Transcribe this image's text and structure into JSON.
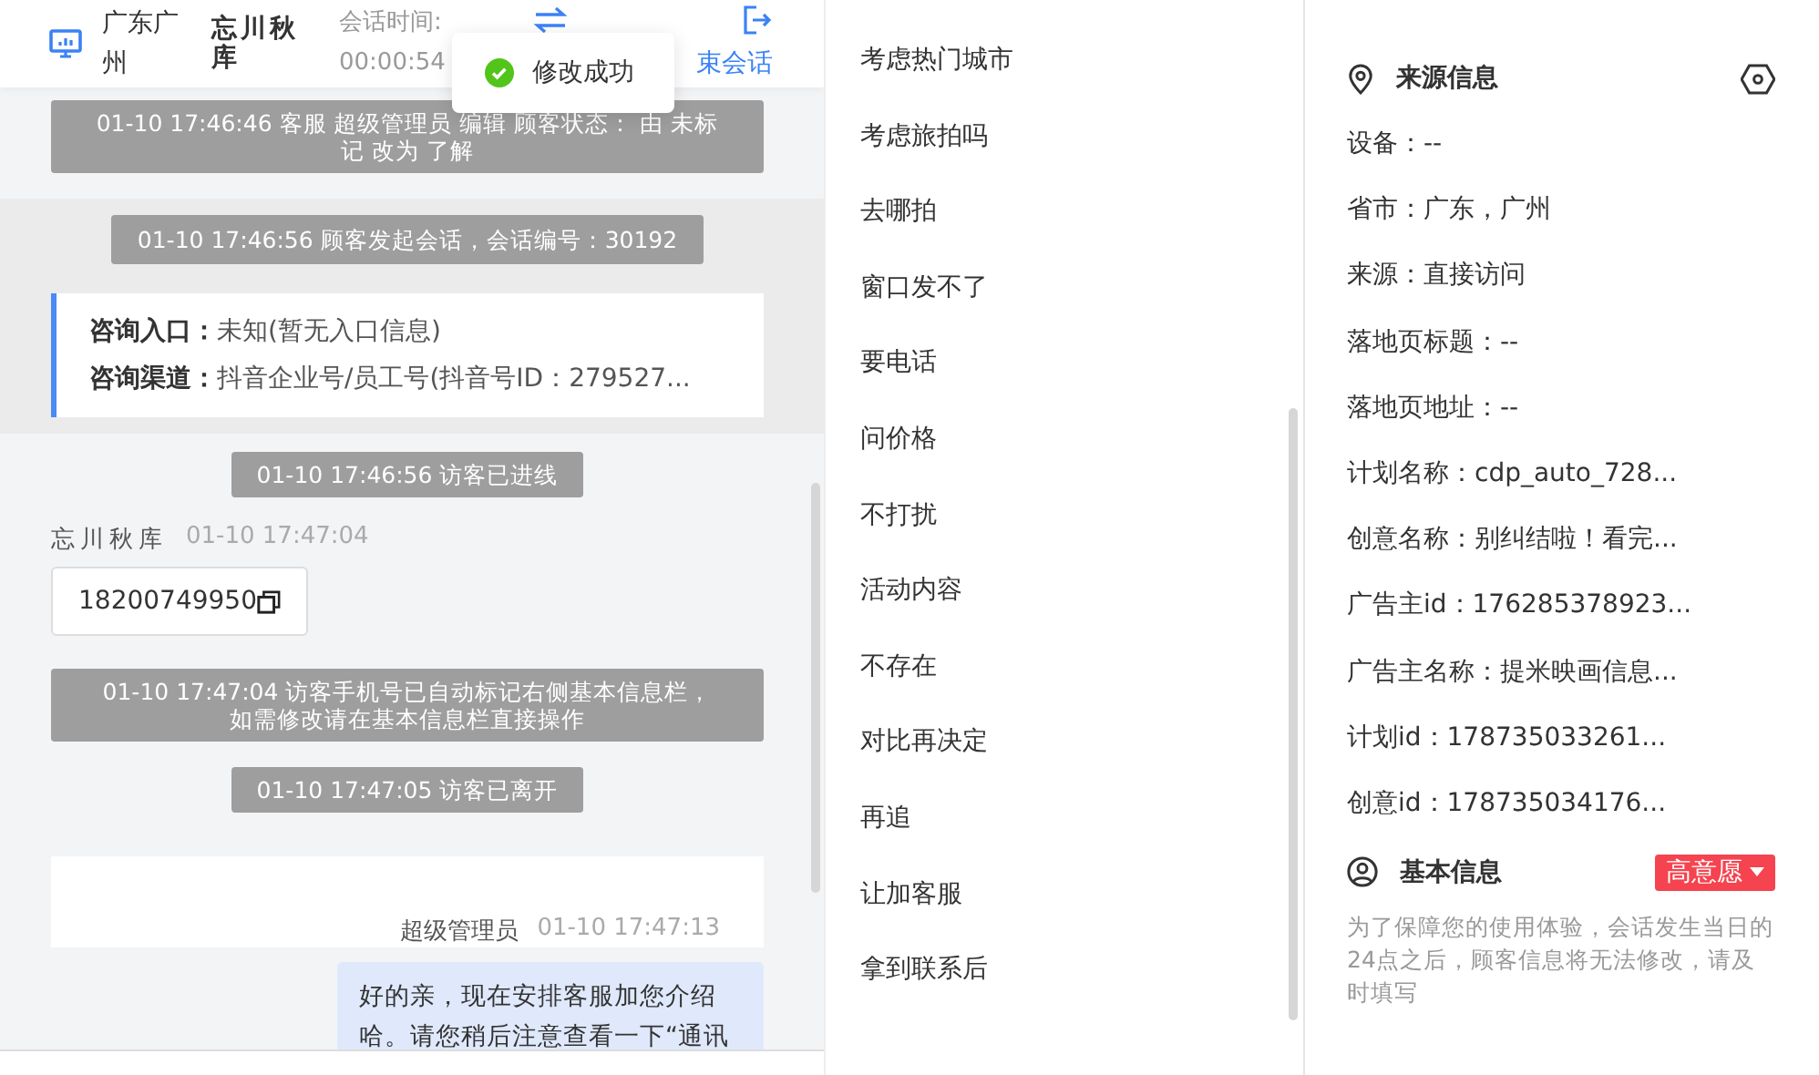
{
  "header": {
    "location": "广东广州",
    "visitor": "忘川秋库",
    "session_time_label": "会话时间:",
    "session_time": "00:00:54",
    "end_label": "束会话"
  },
  "toast": {
    "text": "修改成功"
  },
  "messages": [
    {
      "kind": "system",
      "lines": [
        "01-10 17:46:46 客服 超级管理员 编辑 顾客状态： 由 未标",
        "记 改为 了解"
      ]
    },
    {
      "kind": "session_start",
      "notice": "01-10 17:46:56 顾客发起会话，会话编号：30192",
      "rows": [
        {
          "label": "咨询入口：",
          "value": "未知(暂无入口信息)"
        },
        {
          "label": "咨询渠道：",
          "value": "抖音企业号/员工号(抖音号ID：279527..."
        }
      ]
    },
    {
      "kind": "system",
      "lines": [
        "01-10 17:46:56 访客已进线"
      ]
    },
    {
      "kind": "visitor",
      "sender": "忘川秋库",
      "time": "01-10 17:47:04",
      "text": "18200749950"
    },
    {
      "kind": "system",
      "lines": [
        "01-10 17:47:04 访客手机号已自动标记右侧基本信息栏，",
        "如需修改请在基本信息栏直接操作"
      ]
    },
    {
      "kind": "system",
      "lines": [
        "01-10 17:47:05 访客已离开"
      ]
    },
    {
      "kind": "agent",
      "sender": "超级管理员",
      "time": "01-10 17:47:13",
      "lines": [
        "好的亲，现在安排客服加您介绍",
        "哈。请您稍后注意查看一下“通讯"
      ]
    }
  ],
  "quick_replies": [
    "考虑热门城市",
    "考虑旅拍吗",
    "去哪拍",
    "窗口发不了",
    "要电话",
    "问价格",
    "不打扰",
    "活动内容",
    "不存在",
    "对比再决定",
    "再追",
    "让加客服",
    "拿到联系后"
  ],
  "source_info": {
    "title": "来源信息",
    "fields": [
      "设备：--",
      "省市：广东，广州",
      "来源：直接访问",
      "落地页标题：--",
      "落地页地址：--",
      "计划名称：cdp_auto_728...",
      "创意名称：别纠结啦！看完...",
      "广告主id：176285378923...",
      "广告主名称：提米映画信息...",
      "计划id：178735033261...",
      "创意id：178735034176..."
    ]
  },
  "basic_info": {
    "title": "基本信息",
    "tag": "高意愿",
    "note": "为了保障您的使用体验，会话发生当日的24点之后，顾客信息将无法修改，请及时填写"
  }
}
